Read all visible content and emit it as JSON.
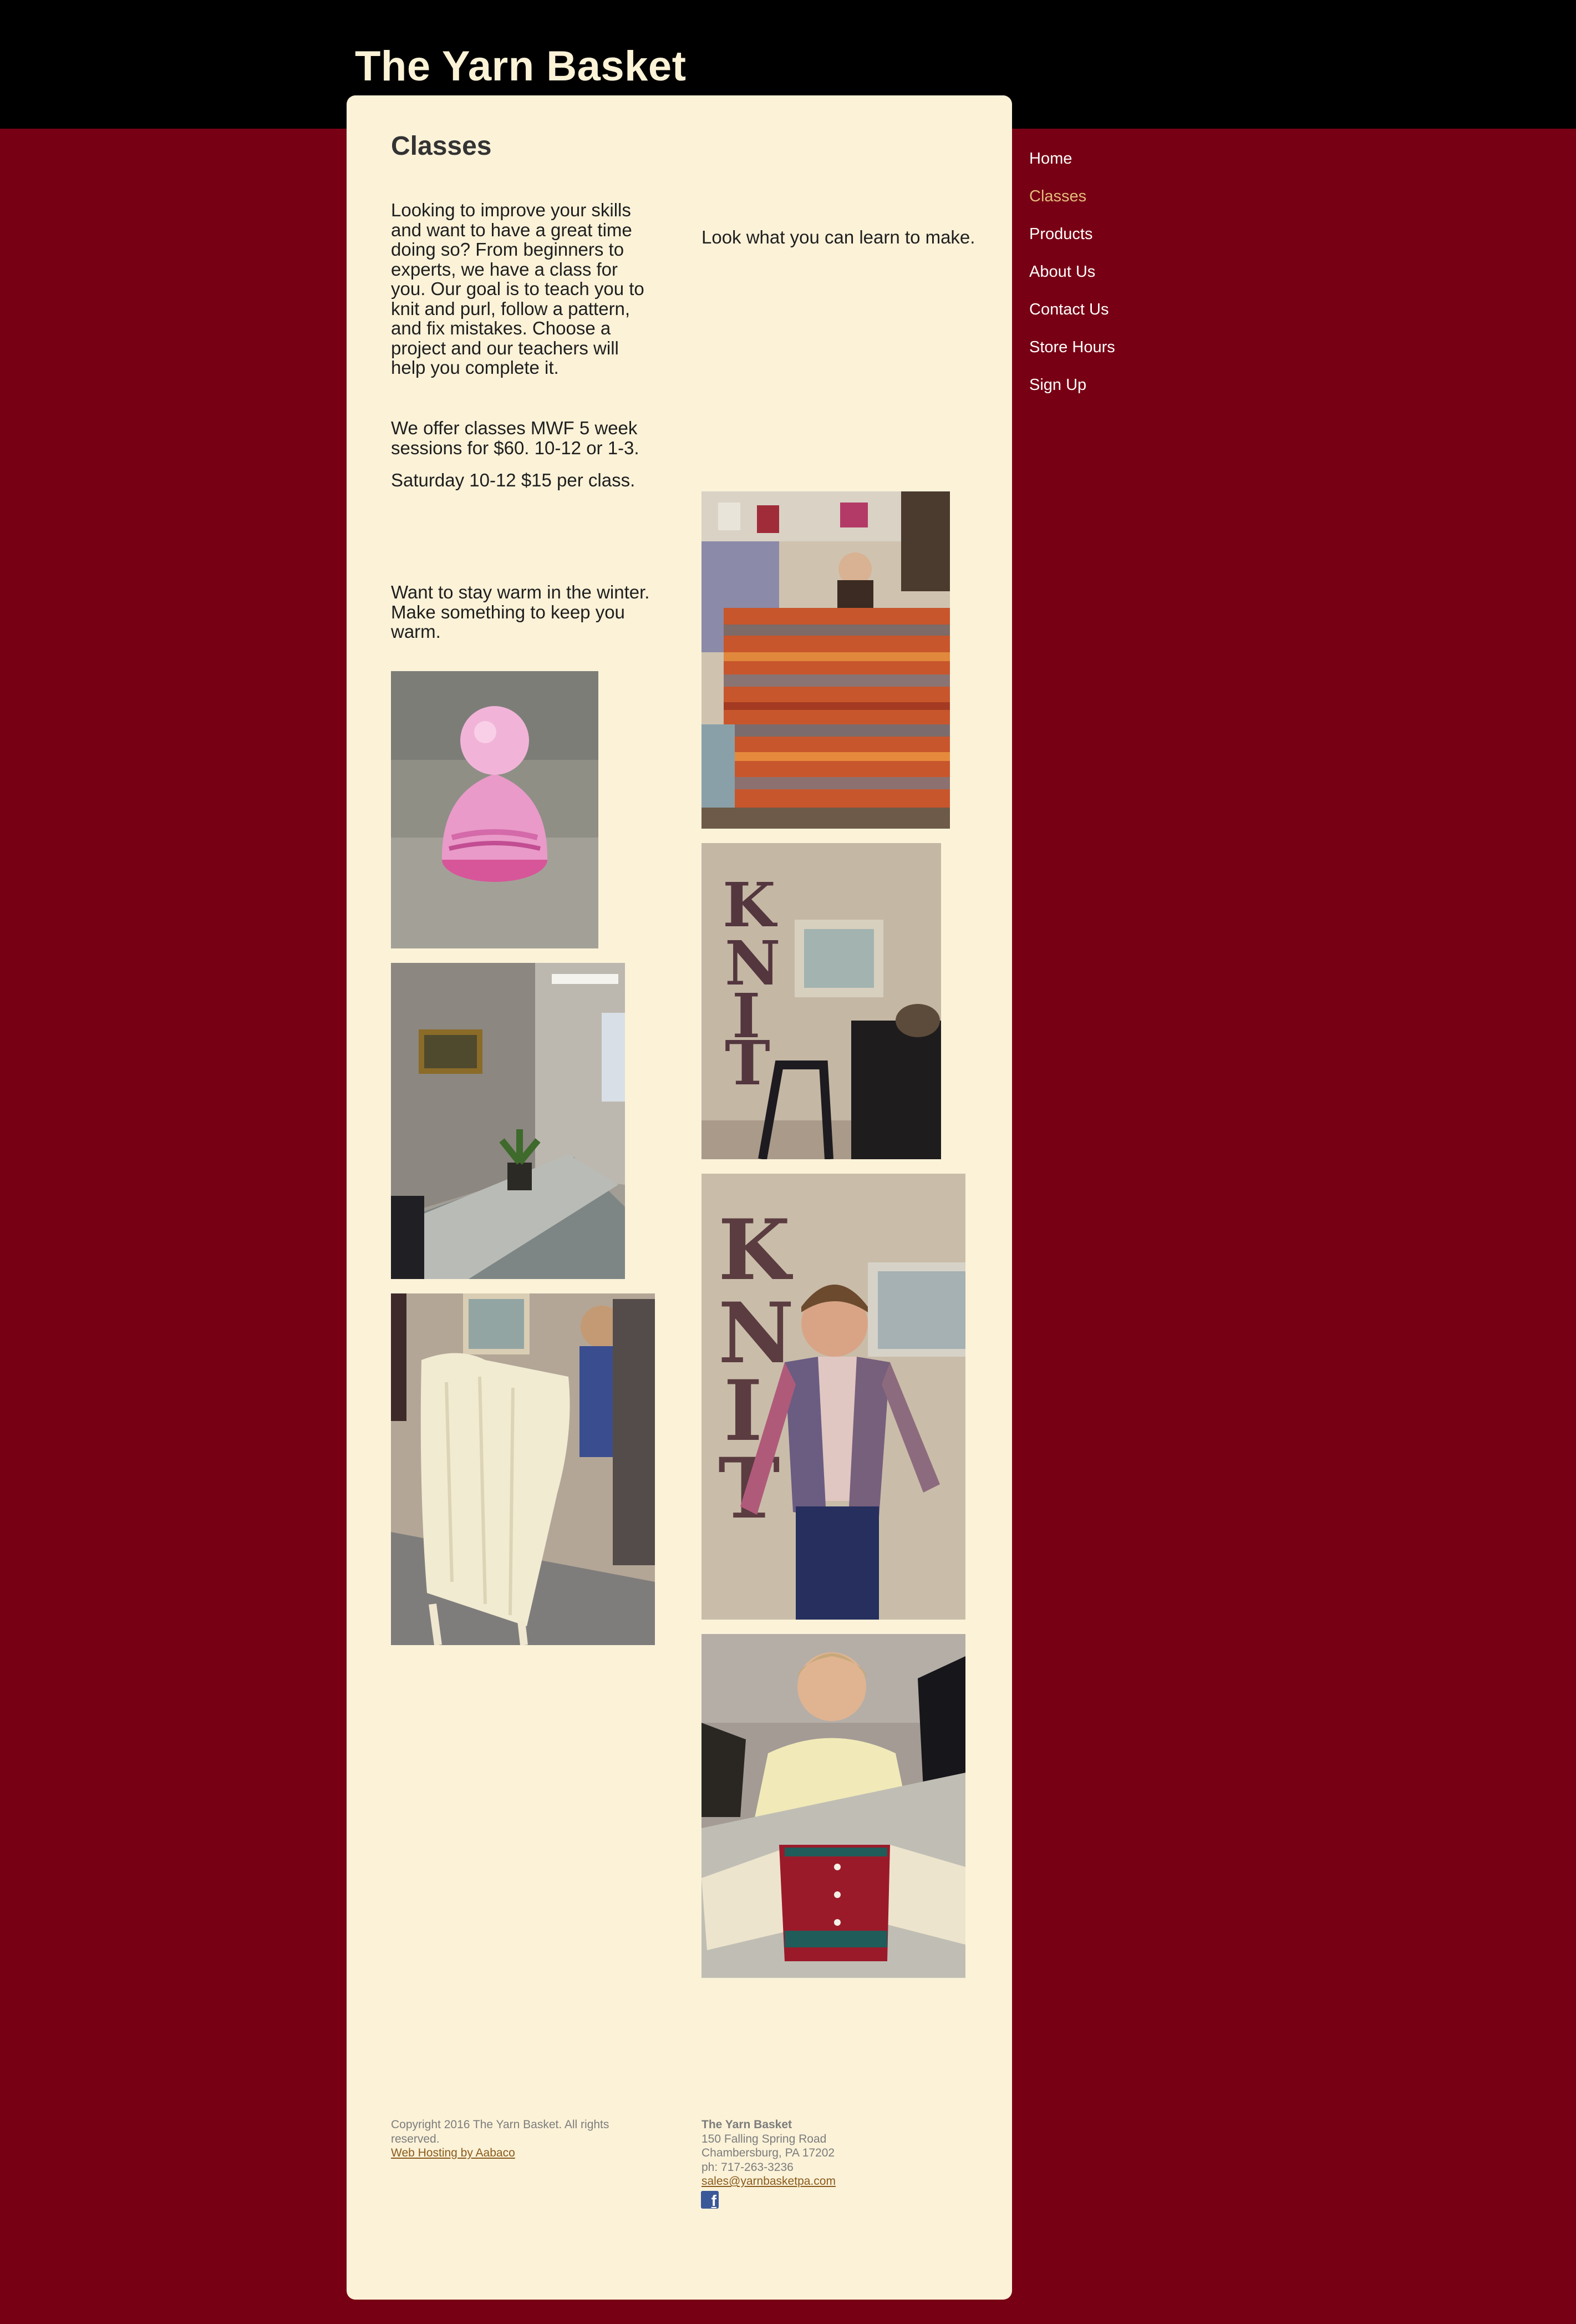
{
  "site": {
    "title": "The Yarn Basket"
  },
  "nav": {
    "items": [
      {
        "label": "Home"
      },
      {
        "label": "Classes",
        "active": true
      },
      {
        "label": "Products"
      },
      {
        "label": "About Us"
      },
      {
        "label": "Contact Us"
      },
      {
        "label": "Store Hours"
      },
      {
        "label": "Sign Up"
      }
    ]
  },
  "main": {
    "title": "Classes",
    "intro": "Looking to improve your skills and want to have a great time doing so?  From beginners to experts, we have a class for you.  Our goal is to teach you to knit and purl, follow a pattern, and fix mistakes.  Choose a project and our teachers will help you complete it.",
    "schedule_weekday": "We offer classes MWF 5 week sessions for $60.  10-12 or 1-3.",
    "schedule_saturday": "Saturday 10-12 $15 per class.",
    "winter": "Want to stay warm in the winter. Make something to keep you warm.",
    "look": "Look what you can learn to make."
  },
  "footer": {
    "copyright": "Copyright 2016 The Yarn Basket. All rights reserved.",
    "hosting_link": "Web Hosting by Aabaco",
    "store_name": "The Yarn Basket",
    "address_line1": "150 Falling Spring Road",
    "address_line2": "Chambersburg, PA 17202",
    "phone": "ph: 717-263-3236",
    "email": "sales@yarnbasketpa.com"
  },
  "colors": {
    "background": "#780014",
    "header": "#000000",
    "panel": "#fbf2d8",
    "title": "#fcf2d6",
    "nav_active": "#e3bd7e",
    "link": "#8a5a1c"
  }
}
